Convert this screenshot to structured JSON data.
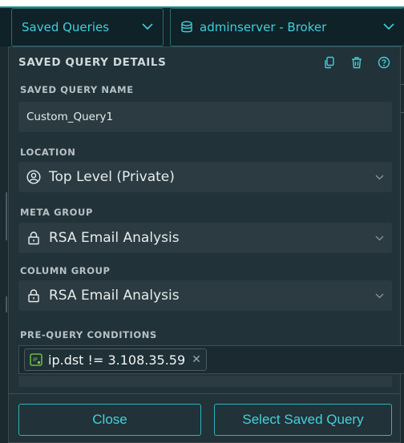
{
  "topbar": {
    "saved_queries_label": "Saved Queries",
    "server_label": "adminserver - Broker"
  },
  "panel": {
    "title": "SAVED QUERY DETAILS",
    "name_label": "SAVED QUERY NAME",
    "name_value": "Custom_Query1",
    "location_label": "LOCATION",
    "location_value": "Top Level (Private)",
    "meta_group_label": "META GROUP",
    "meta_group_value": "RSA Email Analysis",
    "column_group_label": "COLUMN GROUP",
    "column_group_value": "RSA Email Analysis",
    "prequery_label": "PRE-QUERY CONDITIONS",
    "prequery_pill": "ip.dst != 3.108.35.59"
  },
  "buttons": {
    "close": "Close",
    "select": "Select Saved Query"
  },
  "icons": {
    "copy": "copy-icon",
    "delete": "trash-icon",
    "help": "help-icon",
    "database": "database-icon",
    "user": "user-icon",
    "lock": "lock-icon",
    "meta": "meta-key-icon"
  },
  "colors": {
    "accent": "#3fd0da",
    "panel": "#213238",
    "field": "#2b3b41"
  }
}
